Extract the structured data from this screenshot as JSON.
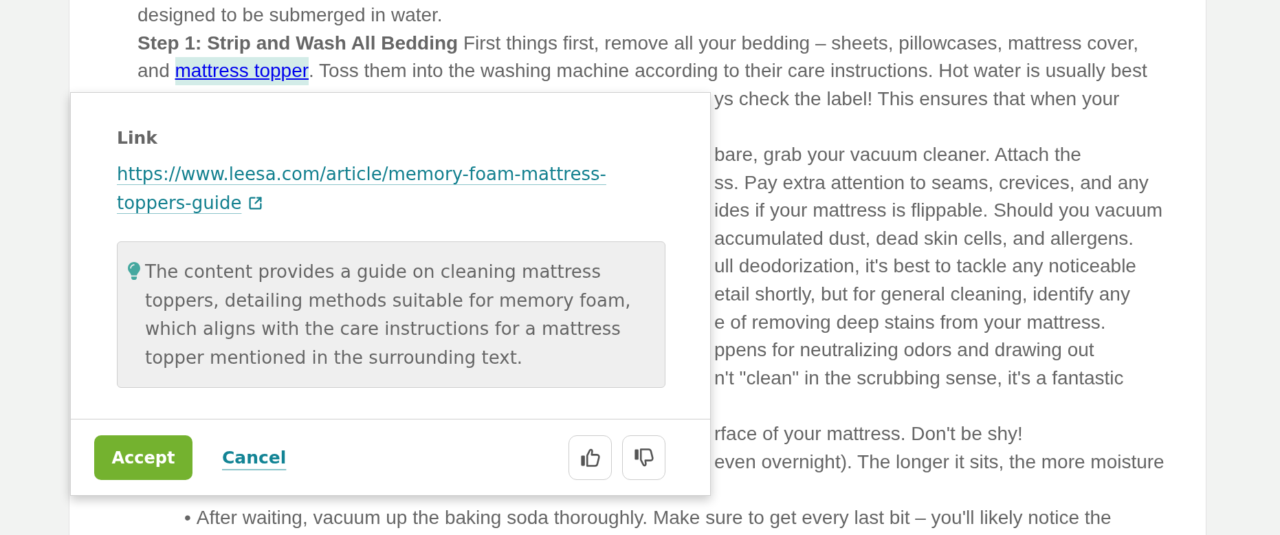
{
  "article": {
    "lines": [
      {
        "kind": "text",
        "text": "designed to be submerged in water."
      },
      {
        "kind": "text",
        "text": "**Step 1: Strip and Wash All Bedding** First things first, remove all your bedding – sheets, pillowcases, mattress cover,"
      },
      {
        "kind": "link_line",
        "before": "and ",
        "link": "mattress topper",
        "after": ". Toss them into the washing machine according to their care instructions. Hot water is usually best",
        "highlighted": true
      },
      {
        "kind": "fragment",
        "text": "ys check the label! This ensures that when your"
      },
      {
        "kind": "blank"
      },
      {
        "kind": "fragment",
        "text": "bare, grab your vacuum cleaner. Attach the"
      },
      {
        "kind": "fragment",
        "text": "ss. Pay extra attention to seams, crevices, and any"
      },
      {
        "kind": "fragment",
        "text": "ides if your mattress is flippable. Should you vacuum"
      },
      {
        "kind": "fragment",
        "text": "accumulated dust, dead skin cells, and allergens."
      },
      {
        "kind": "fragment",
        "text": "ull deodorization, it's best to tackle any noticeable"
      },
      {
        "kind": "fragment",
        "text": "etail shortly, but for general cleaning, identify any"
      },
      {
        "kind": "fragment",
        "text": "e of removing deep stains from your mattress."
      },
      {
        "kind": "fragment",
        "text": "ppens for neutralizing odors and drawing out"
      },
      {
        "kind": "fragment",
        "text": "n't \"clean\" in the scrubbing sense, it's a fantastic"
      },
      {
        "kind": "blank"
      },
      {
        "kind": "fragment",
        "text": "rface of your mattress. Don't be shy!"
      },
      {
        "kind": "fragment",
        "text": "even overnight). The longer it sits, the more moisture"
      },
      {
        "kind": "blank"
      },
      {
        "kind": "bullet",
        "bullet": "•",
        "text": "After waiting, vacuum up the baking soda thoroughly. Make sure to get every last bit – you'll likely notice the"
      }
    ]
  },
  "popup": {
    "heading": "Link",
    "url": "https://www.leesa.com/article/memory-foam-mattress-toppers-guide",
    "summary": "The content provides a guide on cleaning mattress toppers, detailing methods suitable for memory foam, which aligns with the care instructions for a mattress topper mentioned in the surrounding text.",
    "accept": "Accept",
    "cancel": "Cancel",
    "feedback": [
      {
        "kind": "up"
      },
      {
        "kind": "down"
      }
    ]
  }
}
